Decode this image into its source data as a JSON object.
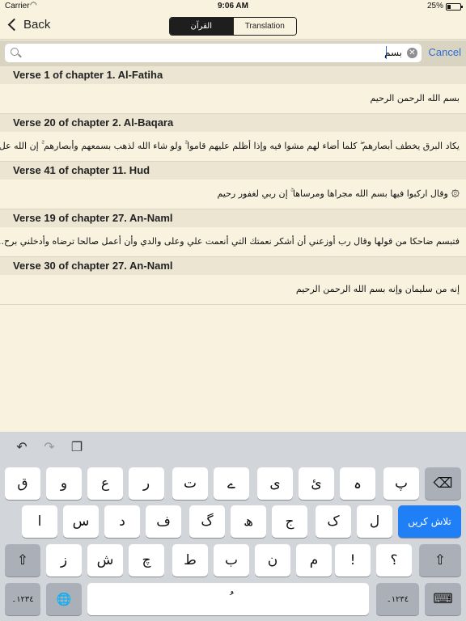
{
  "status": {
    "carrier": "Carrier",
    "time": "9:06 AM",
    "battery": "25%"
  },
  "nav": {
    "back_label": "Back",
    "segments": [
      {
        "label": "القرآن",
        "active": true
      },
      {
        "label": "Translation",
        "active": false
      }
    ]
  },
  "search": {
    "value": "بسم",
    "cancel_label": "Cancel"
  },
  "results": [
    {
      "title": "Verse 1 of chapter 1. Al-Fatiha",
      "text": "بسم الله الرحمن الرحيم"
    },
    {
      "title": "Verse 20 of chapter 2. Al-Baqara",
      "text": "يكاد البرق يخطف أبصارهم ۖ كلما أضاء لهم مشوا فيه وإذا أظلم عليهم قاموا ۚ ولو شاء الله لذهب بسمعهم وأبصارهم ۚ إن الله عل..."
    },
    {
      "title": "Verse 41 of chapter 11. Hud",
      "text": "۞ وقال اركبوا فيها بسم الله مجراها ومرساها ۚ إن ربي لغفور رحيم"
    },
    {
      "title": "Verse 19 of chapter 27. An-Naml",
      "text": "فتبسم ضاحكا من قولها وقال رب أوزعني أن أشكر نعمتك التي أنعمت علي وعلى والدي وأن أعمل صالحا ترضاه وأدخلني برح..."
    },
    {
      "title": "Verse 30 of chapter 27. An-Naml",
      "text": "إنه من سليمان وإنه بسم الله الرحمن الرحيم"
    }
  ],
  "keyboard": {
    "toolbar": {
      "undo": "↶",
      "redo": "↷",
      "paste": "❐"
    },
    "row1": [
      "ق",
      "و",
      "ع",
      "ر",
      "ت",
      "ے",
      "ی",
      "ئ",
      "ہ",
      "پ"
    ],
    "backspace": "⌫",
    "row2": [
      "ا",
      "س",
      "د",
      "ف",
      "گ",
      "ھ",
      "ج",
      "ک",
      "ل"
    ],
    "return_label": "تلاش کریں",
    "row3": [
      "ز",
      "ش",
      "چ",
      "ط",
      "ب",
      "ن",
      "م",
      "!",
      "؟"
    ],
    "shift": "⇧",
    "numbers_label": "١٢٣٤۔",
    "globe": "🌐",
    "space_symbol": "ُ",
    "dismiss": "⌨"
  }
}
